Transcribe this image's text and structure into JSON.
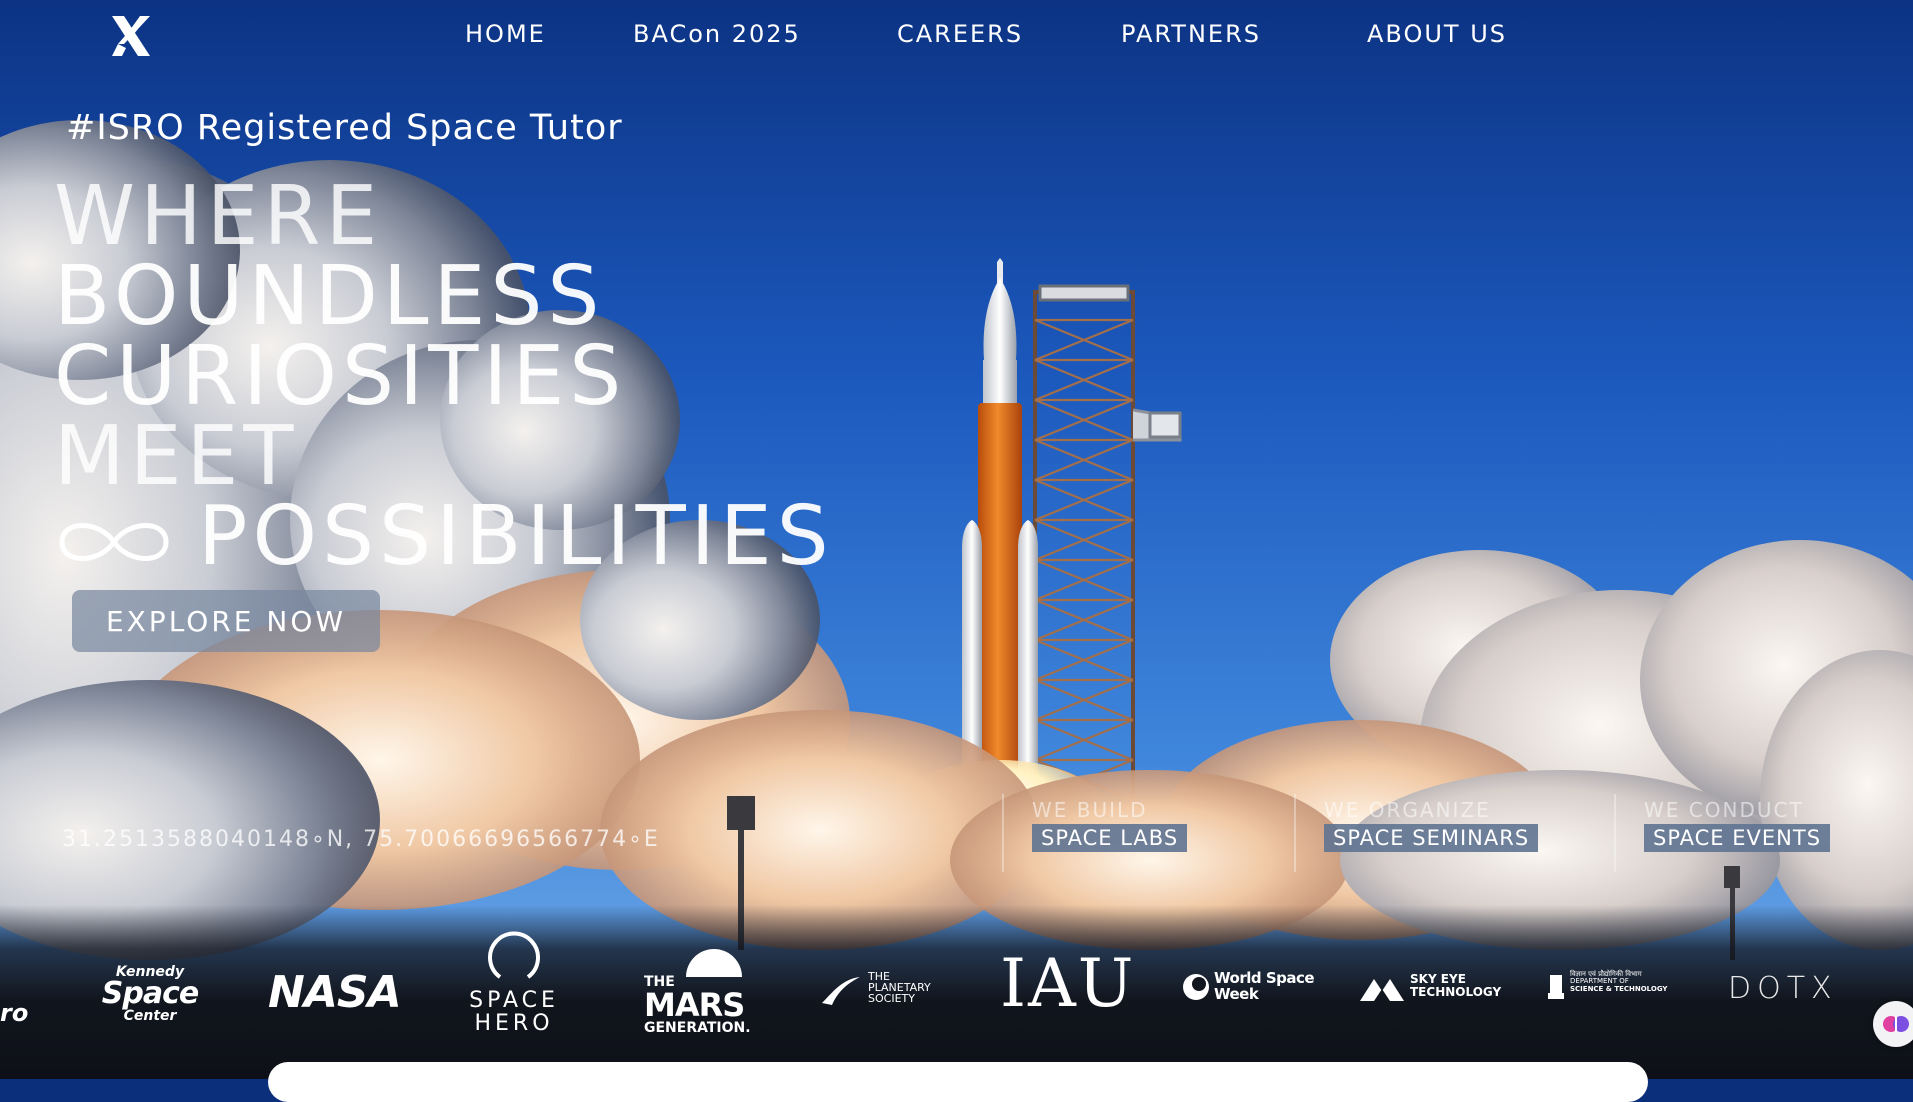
{
  "nav": {
    "items": [
      "HOME",
      "BACon 2025",
      "CAREERS",
      "PARTNERS",
      "ABOUT US"
    ]
  },
  "hero": {
    "tagline": "#ISRO Registered Space Tutor",
    "headline_lines": [
      "WHERE",
      "BOUNDLESS",
      "CURIOSITIES",
      "MEET",
      "POSSIBILITIES"
    ],
    "cta": "EXPLORE NOW",
    "coordinates": "31.2513588040148∘N, 75.70066696566774∘E"
  },
  "features": [
    {
      "kicker": "WE BUILD",
      "tag": "SPACE LABS"
    },
    {
      "kicker": "WE ORGANIZE",
      "tag": "SPACE SEMINARS"
    },
    {
      "kicker": "WE CONDUCT",
      "tag": "SPACE EVENTS"
    }
  ],
  "partners": [
    {
      "name": "Kennedy Space Center",
      "lines": [
        "Kennedy",
        "Space",
        "Center"
      ]
    },
    {
      "name": "NASA",
      "lines": [
        "NASA"
      ]
    },
    {
      "name": "Space Hero",
      "lines": [
        "SPACE",
        "HERO"
      ]
    },
    {
      "name": "The Mars Generation",
      "lines": [
        "THE",
        "MARS",
        "GENERATION."
      ]
    },
    {
      "name": "The Planetary Society",
      "lines": [
        "THE",
        "PLANETARY",
        "SOCIETY"
      ]
    },
    {
      "name": "IAU",
      "lines": [
        "IAU"
      ]
    },
    {
      "name": "World Space Week",
      "lines": [
        "World Space",
        "Week"
      ]
    },
    {
      "name": "Sky Eye Technology",
      "lines": [
        "SKY EYE",
        "TECHNOLOGY"
      ]
    },
    {
      "name": "Department of Science & Technology",
      "lines": [
        "विज्ञान एवं प्रौद्योगिकी विभाग",
        "DEPARTMENT OF",
        "SCIENCE & TECHNOLOGY"
      ]
    },
    {
      "name": "DOTX",
      "lines": [
        "DOTX"
      ]
    }
  ],
  "partial_logo_text": "ro",
  "colors": {
    "sky_top": "#0d3a92",
    "sky_mid": "#2a6fd0",
    "sky_low": "#6aa4e6",
    "rocket_orange": "#e06a17",
    "cta_bg": "#7888a0",
    "feature_tag_bg": "#5f7391",
    "strip_bg": "#11151d"
  }
}
